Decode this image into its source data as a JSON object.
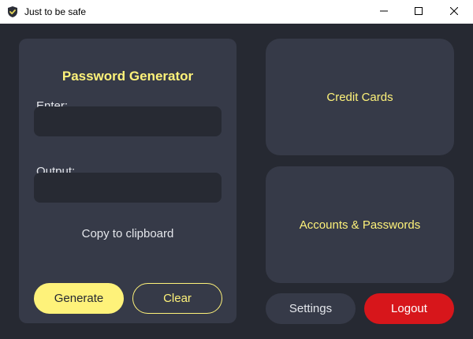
{
  "window": {
    "title": "Just to be safe",
    "controls": {
      "minimize_icon": "minimize-icon",
      "maximize_icon": "maximize-icon",
      "close_icon": "close-icon"
    },
    "app_icon": "shield-check-icon"
  },
  "generator": {
    "title": "Password Generator",
    "enter_label": "Enter:",
    "enter_value": "",
    "output_label": "Output:",
    "output_value": "",
    "copy_label": "Copy to clipboard",
    "generate_label": "Generate",
    "clear_label": "Clear"
  },
  "nav": {
    "credit_cards_label": "Credit Cards",
    "accounts_label": "Accounts & Passwords",
    "settings_label": "Settings",
    "logout_label": "Logout"
  },
  "colors": {
    "background": "#262932",
    "card": "#363a48",
    "field": "#272a33",
    "accent": "#fef27a",
    "danger": "#d7161b",
    "text": "#e4e6eb"
  }
}
